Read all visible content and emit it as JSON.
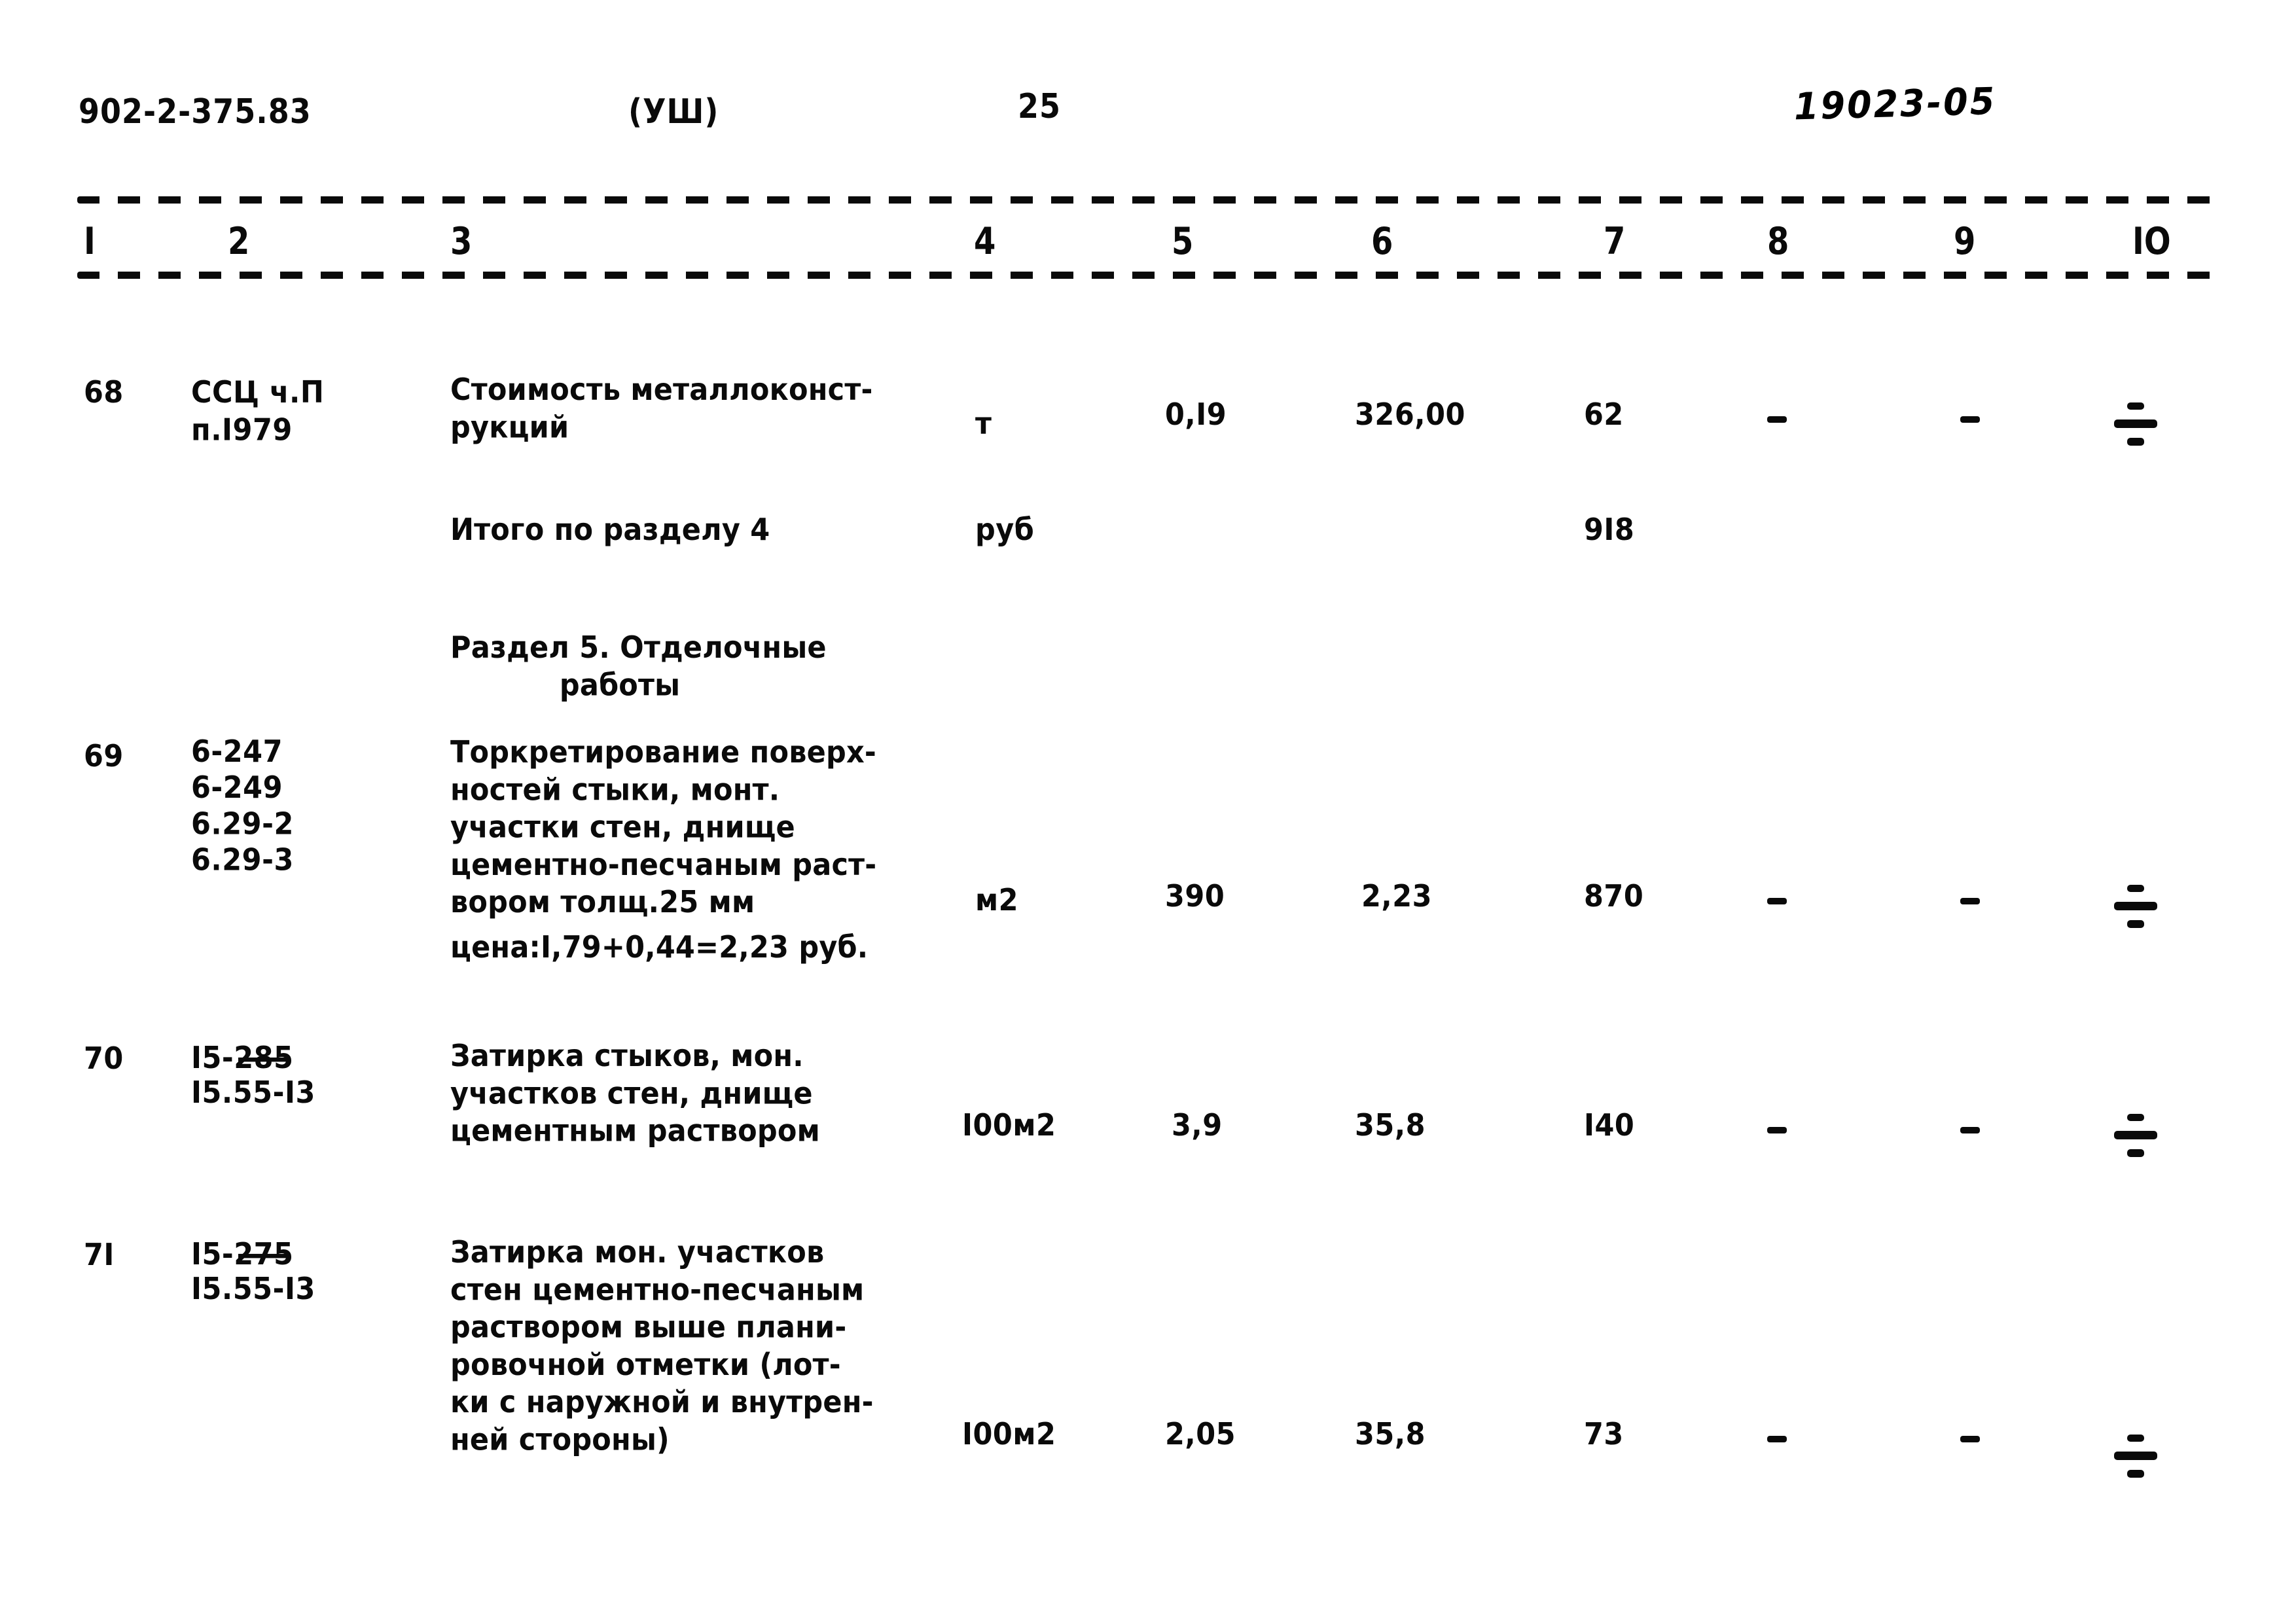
{
  "header": {
    "doc_code": "902-2-375.83",
    "variant": "(УШ)",
    "page_number": "25",
    "handwritten_code": "19023-05"
  },
  "table": {
    "column_numbers": [
      "I",
      "2",
      "3",
      "4",
      "5",
      "6",
      "7",
      "8",
      "9",
      "IO"
    ],
    "rows": [
      {
        "no": "68",
        "code": "ССЦ ч.П\nп.I979",
        "description": "Стоимость металлоконст-\nрукций",
        "unit": "т",
        "qty": "0,I9",
        "price": "326,00",
        "total": "62",
        "col8": "-",
        "col9": "-",
        "col10": "÷"
      },
      {
        "no": "",
        "code": "",
        "description": "Итого по разделу 4",
        "unit": "руб",
        "qty": "",
        "price": "",
        "total": "9I8",
        "col8": "",
        "col9": "",
        "col10": ""
      },
      {
        "no": "",
        "code": "",
        "description": "Раздел 5. Отделочные\n           работы",
        "unit": "",
        "qty": "",
        "price": "",
        "total": "",
        "col8": "",
        "col9": "",
        "col10": ""
      },
      {
        "no": "69",
        "code": "6-247\n6-249\n6.29-2\n6.29-3",
        "description": "Торкретирование поверх-\nностей стыки, монт.\nучастки стен, днище\nцементно-песчаным раст-\nвором толщ.25 мм",
        "note": "цена:I,79+0,44=2,23 руб.",
        "unit": "м2",
        "qty": "390",
        "price": "2,23",
        "total": "870",
        "col8": "-",
        "col9": "-",
        "col10": "÷"
      },
      {
        "no": "70",
        "code_struck": "I5-285",
        "code": "I5.55-I3",
        "description": "Затирка стыков, мон.\nучастков стен, днище\nцементным раствором",
        "unit": "I00м2",
        "qty": "3,9",
        "price": "35,8",
        "total": "I40",
        "col8": "-",
        "col9": "-",
        "col10": "÷"
      },
      {
        "no": "7I",
        "code_struck": "I5-275",
        "code": "I5.55-I3",
        "description": "Затирка мон. участков\nстен цементно-песчаным\nраствором выше плани-\nровочной отметки (лот-\nки с наружной и внутрен-\nней стороны)",
        "unit": "I00м2",
        "qty": "2,05",
        "price": "35,8",
        "total": "73",
        "col8": "-",
        "col9": "-",
        "col10": "÷"
      }
    ]
  }
}
